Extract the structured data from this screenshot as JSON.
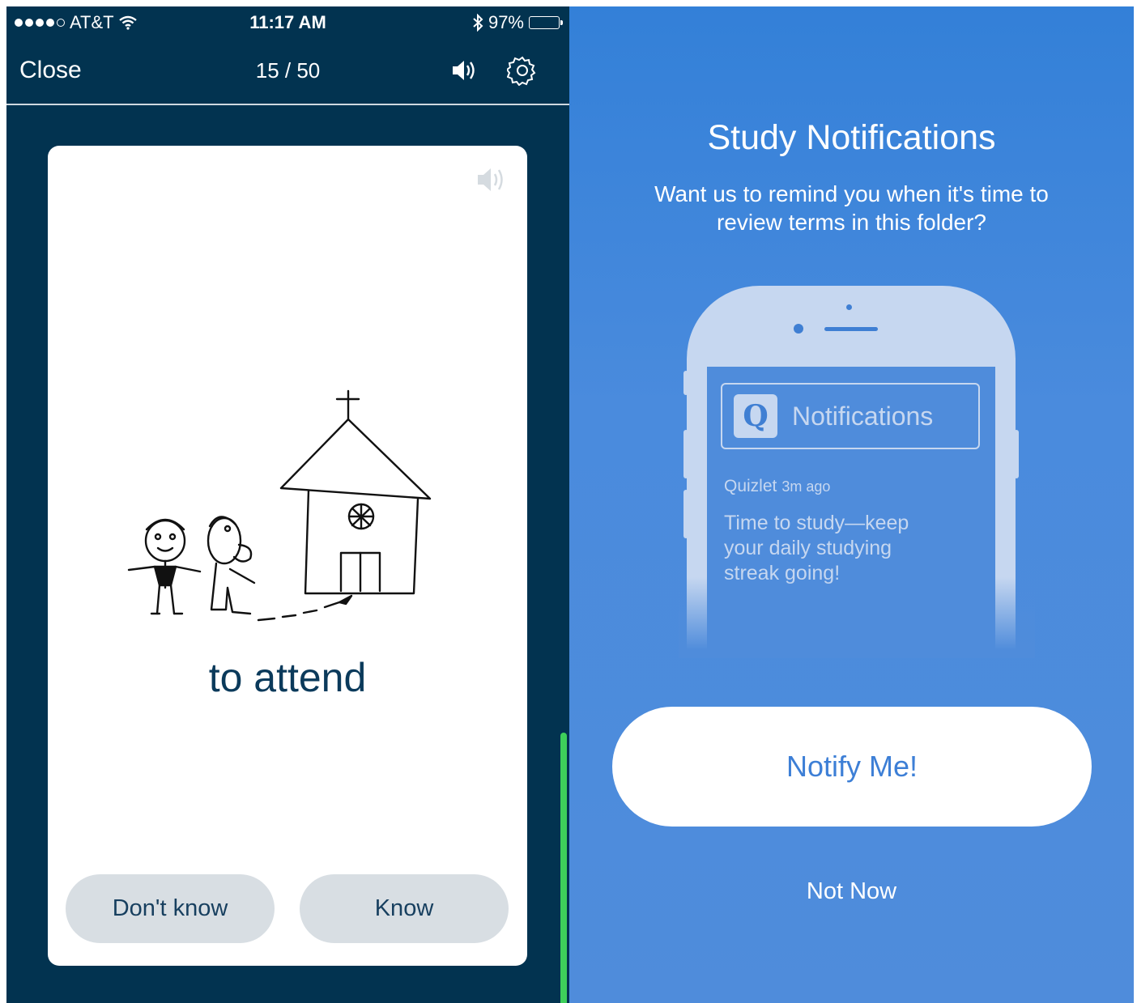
{
  "left_screen": {
    "status_bar": {
      "carrier": "AT&T",
      "time": "11:17 AM",
      "battery": "97%",
      "battery_level": 0.97
    },
    "nav": {
      "close_label": "Close",
      "progress": "15 / 50",
      "speaker_icon": "speaker-icon",
      "settings_icon": "gear-icon"
    },
    "card": {
      "term": "to attend",
      "image": "church-sketch",
      "buttons": {
        "dont_know": "Don't know",
        "know": "Know"
      }
    },
    "colors": {
      "background": "#023350",
      "card": "#ffffff",
      "accent_green": "#3ecf5a"
    }
  },
  "right_screen": {
    "title": "Study Notifications",
    "subtitle": "Want us to remind you when it's time to review terms in this folder?",
    "phone_illustration": {
      "app_letter": "Q",
      "header": "Notifications",
      "app_name": "Quizlet",
      "time_ago": "3m ago",
      "message": "Time to study—keep your daily studying streak going!"
    },
    "primary_button": "Notify Me!",
    "secondary_button": "Not Now",
    "colors": {
      "background": "#4f8cdb",
      "button_text": "#3d7fd6"
    }
  }
}
